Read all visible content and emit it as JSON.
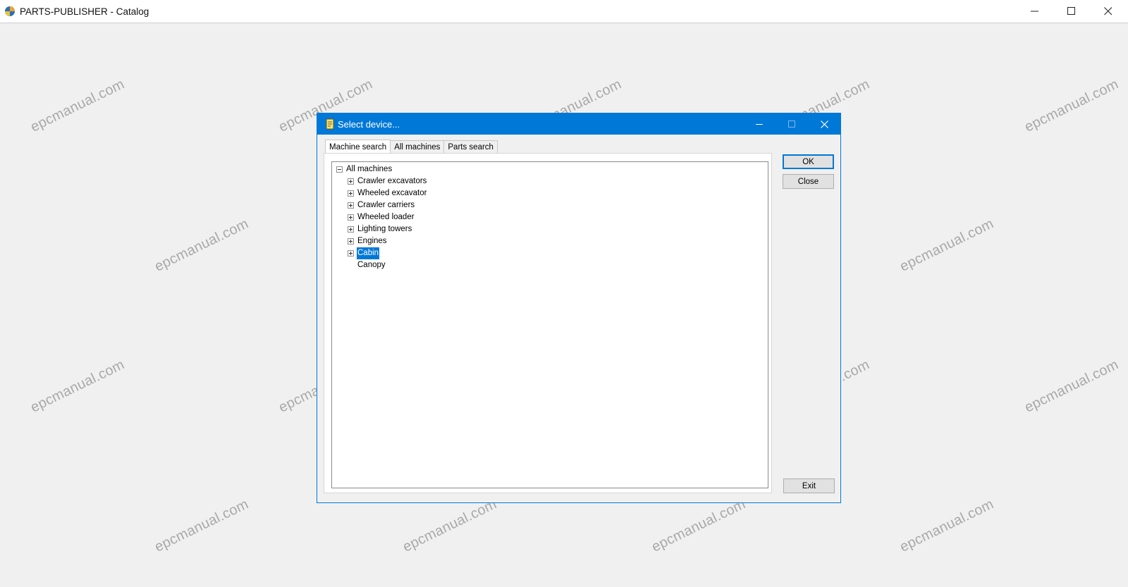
{
  "app": {
    "title": "PARTS-PUBLISHER - Catalog"
  },
  "dialog": {
    "title": "Select device...",
    "tabs": [
      {
        "label": "Machine search",
        "active": true
      },
      {
        "label": "All machines",
        "active": false
      },
      {
        "label": "Parts search",
        "active": false
      }
    ],
    "tree": {
      "root": "All machines",
      "children": [
        {
          "label": "Crawler excavators",
          "expandable": true,
          "selected": false
        },
        {
          "label": "Wheeled excavator",
          "expandable": true,
          "selected": false
        },
        {
          "label": "Crawler carriers",
          "expandable": true,
          "selected": false
        },
        {
          "label": "Wheeled loader",
          "expandable": true,
          "selected": false
        },
        {
          "label": "Lighting towers",
          "expandable": true,
          "selected": false
        },
        {
          "label": "Engines",
          "expandable": true,
          "selected": false
        },
        {
          "label": "Cabin",
          "expandable": true,
          "selected": true
        },
        {
          "label": "Canopy",
          "expandable": false,
          "selected": false
        }
      ]
    },
    "buttons": {
      "ok": "OK",
      "close": "Close",
      "exit": "Exit"
    }
  },
  "watermark": "epcmanual.com",
  "colors": {
    "accent": "#0078d7",
    "background": "#f0f0f0"
  }
}
